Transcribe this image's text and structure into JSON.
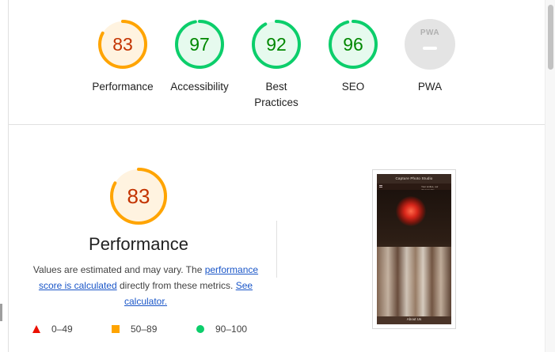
{
  "colors": {
    "average": "#ffa400",
    "average_text": "#c33300",
    "pass": "#0cce6b",
    "pass_text": "#008800",
    "fail": "#eb0f00",
    "na": "#e4e4e4",
    "link": "#1a56c8"
  },
  "summary": {
    "gauges": [
      {
        "score": "83",
        "label": "Performance",
        "status": "average",
        "fraction": 0.83
      },
      {
        "score": "97",
        "label": "Accessibility",
        "status": "pass",
        "fraction": 0.97
      },
      {
        "score": "92",
        "label": "Best Practices",
        "status": "pass",
        "fraction": 0.92
      },
      {
        "score": "96",
        "label": "SEO",
        "status": "pass",
        "fraction": 0.96
      }
    ],
    "pwa": {
      "badge_text": "PWA",
      "label": "PWA"
    }
  },
  "performance": {
    "score": "83",
    "fraction": 0.83,
    "title": "Performance",
    "desc_prefix": "Values are estimated and may vary. The ",
    "desc_link1": "performance score is calculated",
    "desc_middle": " directly from these metrics. ",
    "desc_link2": "See calculator.",
    "legend": [
      {
        "range": "0–49",
        "icon": "triangle-icon"
      },
      {
        "range": "50–89",
        "icon": "square-icon"
      },
      {
        "range": "90–100",
        "icon": "circle-icon"
      }
    ]
  },
  "screenshot": {
    "header": "Capture Photo Studio",
    "subheader": "Your smiles, our photographs",
    "footer": "About Us"
  }
}
